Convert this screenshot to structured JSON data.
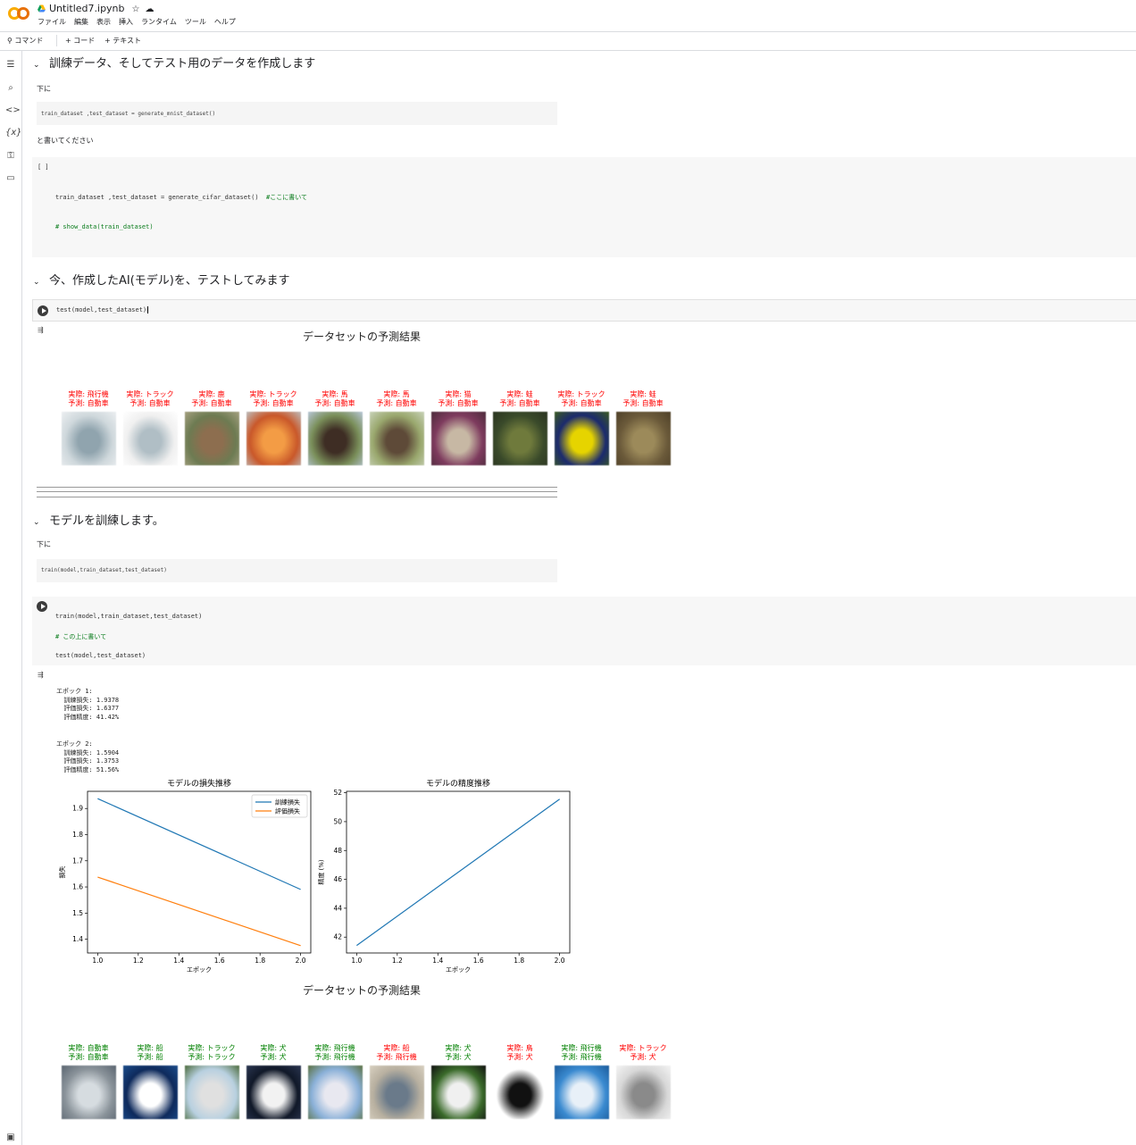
{
  "header": {
    "title": "Untitled7.ipynb",
    "menu": [
      "ファイル",
      "編集",
      "表示",
      "挿入",
      "ランタイム",
      "ツール",
      "ヘルプ"
    ]
  },
  "toolbar": {
    "command": "コマンド",
    "add_code": "+ コード",
    "add_text": "+ テキスト"
  },
  "sections": {
    "s1": "訓練データ、そしてテスト用のデータを作成します",
    "s2": "今、作成したAI(モデル)を、テストしてみます",
    "s3": "モデルを訓練します。"
  },
  "text1": {
    "below": "下に",
    "code": "train_dataset ,test_dataset = generate_mnist_dataset()",
    "write": "と書いてください"
  },
  "cell1": {
    "bracket": "[ ]",
    "line1_code": "train_dataset ,test_dataset = generate_cifar_dataset()",
    "line1_comment": "#ここに書いて",
    "line2": "# show_data(train_dataset)"
  },
  "cell2": {
    "code": "test(model,test_dataset)"
  },
  "output1": {
    "title": "データセットの予測結果",
    "items": [
      {
        "actual": "実際: 飛行機",
        "pred": "予測: 自動車",
        "color": "#ff0000"
      },
      {
        "actual": "実際: トラック",
        "pred": "予測: 自動車",
        "color": "#ff0000"
      },
      {
        "actual": "実際: 鹿",
        "pred": "予測: 自動車",
        "color": "#ff0000"
      },
      {
        "actual": "実際: トラック",
        "pred": "予測: 自動車",
        "color": "#ff0000"
      },
      {
        "actual": "実際: 馬",
        "pred": "予測: 自動車",
        "color": "#ff0000"
      },
      {
        "actual": "実際: 馬",
        "pred": "予測: 自動車",
        "color": "#ff0000"
      },
      {
        "actual": "実際: 猫",
        "pred": "予測: 自動車",
        "color": "#ff0000"
      },
      {
        "actual": "実際: 蛙",
        "pred": "予測: 自動車",
        "color": "#ff0000"
      },
      {
        "actual": "実際: トラック",
        "pred": "予測: 自動車",
        "color": "#ff0000"
      },
      {
        "actual": "実際: 蛙",
        "pred": "予測: 自動車",
        "color": "#ff0000"
      }
    ]
  },
  "text2": {
    "below": "下に",
    "code": "train(model,train_dataset,test_dataset)"
  },
  "cell3": {
    "line1": "train(model,train_dataset,test_dataset)",
    "line2": "# この上に書いて",
    "line3": "test(model,test_dataset)"
  },
  "log": {
    "epoch1": "エポック 1:\n  訓練損失: 1.9378\n  評価損失: 1.6377\n  評価精度: 41.42%",
    "epoch2": "エポック 2:\n  訓練損失: 1.5904\n  評価損失: 1.3753\n  評価精度: 51.56%"
  },
  "chart_data": [
    {
      "type": "line",
      "title": "モデルの損失推移",
      "xlabel": "エポック",
      "ylabel": "損失",
      "x": [
        1.0,
        2.0
      ],
      "xlim": [
        0.95,
        2.05
      ],
      "ylim": [
        1.3475,
        1.9656
      ],
      "xticks": [
        "1.0",
        "1.2",
        "1.4",
        "1.6",
        "1.8",
        "2.0"
      ],
      "yticks": [
        "1.4",
        "1.5",
        "1.6",
        "1.7",
        "1.8",
        "1.9"
      ],
      "legend": "top-right",
      "series": [
        {
          "name": "訓練損失",
          "values": [
            1.9378,
            1.5904
          ],
          "color": "#1f77b4"
        },
        {
          "name": "評価損失",
          "values": [
            1.6377,
            1.3753
          ],
          "color": "#ff7f0e"
        }
      ]
    },
    {
      "type": "line",
      "title": "モデルの精度推移",
      "xlabel": "エポック",
      "ylabel": "精度 (%)",
      "x": [
        1.0,
        2.0
      ],
      "xlim": [
        0.95,
        2.05
      ],
      "ylim": [
        40.9,
        52.1
      ],
      "xticks": [
        "1.0",
        "1.2",
        "1.4",
        "1.6",
        "1.8",
        "2.0"
      ],
      "yticks": [
        "42",
        "44",
        "46",
        "48",
        "50",
        "52"
      ],
      "series": [
        {
          "values": [
            41.42,
            51.56
          ],
          "color": "#1f77b4"
        }
      ]
    }
  ],
  "output2": {
    "title": "データセットの予測結果",
    "items": [
      {
        "actual": "実際: 自動車",
        "pred": "予測: 自動車",
        "color": "#008000"
      },
      {
        "actual": "実際: 船",
        "pred": "予測: 船",
        "color": "#008000"
      },
      {
        "actual": "実際: トラック",
        "pred": "予測: トラック",
        "color": "#008000"
      },
      {
        "actual": "実際: 犬",
        "pred": "予測: 犬",
        "color": "#008000"
      },
      {
        "actual": "実際: 飛行機",
        "pred": "予測: 飛行機",
        "color": "#008000"
      },
      {
        "actual": "実際: 船",
        "pred": "予測: 飛行機",
        "color": "#ff0000"
      },
      {
        "actual": "実際: 犬",
        "pred": "予測: 犬",
        "color": "#008000"
      },
      {
        "actual": "実際: 鳥",
        "pred": "予測: 犬",
        "color": "#ff0000"
      },
      {
        "actual": "実際: 飛行機",
        "pred": "予測: 飛行機",
        "color": "#008000"
      },
      {
        "actual": "実際: トラック",
        "pred": "予測: 犬",
        "color": "#ff0000"
      }
    ]
  }
}
